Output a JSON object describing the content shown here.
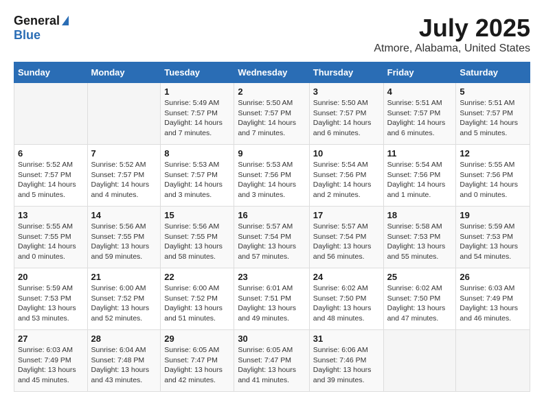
{
  "logo": {
    "general": "General",
    "blue": "Blue"
  },
  "title": "July 2025",
  "subtitle": "Atmore, Alabama, United States",
  "weekdays": [
    "Sunday",
    "Monday",
    "Tuesday",
    "Wednesday",
    "Thursday",
    "Friday",
    "Saturday"
  ],
  "weeks": [
    [
      {
        "day": "",
        "sunrise": "",
        "sunset": "",
        "daylight": ""
      },
      {
        "day": "",
        "sunrise": "",
        "sunset": "",
        "daylight": ""
      },
      {
        "day": "1",
        "sunrise": "Sunrise: 5:49 AM",
        "sunset": "Sunset: 7:57 PM",
        "daylight": "Daylight: 14 hours and 7 minutes."
      },
      {
        "day": "2",
        "sunrise": "Sunrise: 5:50 AM",
        "sunset": "Sunset: 7:57 PM",
        "daylight": "Daylight: 14 hours and 7 minutes."
      },
      {
        "day": "3",
        "sunrise": "Sunrise: 5:50 AM",
        "sunset": "Sunset: 7:57 PM",
        "daylight": "Daylight: 14 hours and 6 minutes."
      },
      {
        "day": "4",
        "sunrise": "Sunrise: 5:51 AM",
        "sunset": "Sunset: 7:57 PM",
        "daylight": "Daylight: 14 hours and 6 minutes."
      },
      {
        "day": "5",
        "sunrise": "Sunrise: 5:51 AM",
        "sunset": "Sunset: 7:57 PM",
        "daylight": "Daylight: 14 hours and 5 minutes."
      }
    ],
    [
      {
        "day": "6",
        "sunrise": "Sunrise: 5:52 AM",
        "sunset": "Sunset: 7:57 PM",
        "daylight": "Daylight: 14 hours and 5 minutes."
      },
      {
        "day": "7",
        "sunrise": "Sunrise: 5:52 AM",
        "sunset": "Sunset: 7:57 PM",
        "daylight": "Daylight: 14 hours and 4 minutes."
      },
      {
        "day": "8",
        "sunrise": "Sunrise: 5:53 AM",
        "sunset": "Sunset: 7:57 PM",
        "daylight": "Daylight: 14 hours and 3 minutes."
      },
      {
        "day": "9",
        "sunrise": "Sunrise: 5:53 AM",
        "sunset": "Sunset: 7:56 PM",
        "daylight": "Daylight: 14 hours and 3 minutes."
      },
      {
        "day": "10",
        "sunrise": "Sunrise: 5:54 AM",
        "sunset": "Sunset: 7:56 PM",
        "daylight": "Daylight: 14 hours and 2 minutes."
      },
      {
        "day": "11",
        "sunrise": "Sunrise: 5:54 AM",
        "sunset": "Sunset: 7:56 PM",
        "daylight": "Daylight: 14 hours and 1 minute."
      },
      {
        "day": "12",
        "sunrise": "Sunrise: 5:55 AM",
        "sunset": "Sunset: 7:56 PM",
        "daylight": "Daylight: 14 hours and 0 minutes."
      }
    ],
    [
      {
        "day": "13",
        "sunrise": "Sunrise: 5:55 AM",
        "sunset": "Sunset: 7:55 PM",
        "daylight": "Daylight: 14 hours and 0 minutes."
      },
      {
        "day": "14",
        "sunrise": "Sunrise: 5:56 AM",
        "sunset": "Sunset: 7:55 PM",
        "daylight": "Daylight: 13 hours and 59 minutes."
      },
      {
        "day": "15",
        "sunrise": "Sunrise: 5:56 AM",
        "sunset": "Sunset: 7:55 PM",
        "daylight": "Daylight: 13 hours and 58 minutes."
      },
      {
        "day": "16",
        "sunrise": "Sunrise: 5:57 AM",
        "sunset": "Sunset: 7:54 PM",
        "daylight": "Daylight: 13 hours and 57 minutes."
      },
      {
        "day": "17",
        "sunrise": "Sunrise: 5:57 AM",
        "sunset": "Sunset: 7:54 PM",
        "daylight": "Daylight: 13 hours and 56 minutes."
      },
      {
        "day": "18",
        "sunrise": "Sunrise: 5:58 AM",
        "sunset": "Sunset: 7:53 PM",
        "daylight": "Daylight: 13 hours and 55 minutes."
      },
      {
        "day": "19",
        "sunrise": "Sunrise: 5:59 AM",
        "sunset": "Sunset: 7:53 PM",
        "daylight": "Daylight: 13 hours and 54 minutes."
      }
    ],
    [
      {
        "day": "20",
        "sunrise": "Sunrise: 5:59 AM",
        "sunset": "Sunset: 7:53 PM",
        "daylight": "Daylight: 13 hours and 53 minutes."
      },
      {
        "day": "21",
        "sunrise": "Sunrise: 6:00 AM",
        "sunset": "Sunset: 7:52 PM",
        "daylight": "Daylight: 13 hours and 52 minutes."
      },
      {
        "day": "22",
        "sunrise": "Sunrise: 6:00 AM",
        "sunset": "Sunset: 7:52 PM",
        "daylight": "Daylight: 13 hours and 51 minutes."
      },
      {
        "day": "23",
        "sunrise": "Sunrise: 6:01 AM",
        "sunset": "Sunset: 7:51 PM",
        "daylight": "Daylight: 13 hours and 49 minutes."
      },
      {
        "day": "24",
        "sunrise": "Sunrise: 6:02 AM",
        "sunset": "Sunset: 7:50 PM",
        "daylight": "Daylight: 13 hours and 48 minutes."
      },
      {
        "day": "25",
        "sunrise": "Sunrise: 6:02 AM",
        "sunset": "Sunset: 7:50 PM",
        "daylight": "Daylight: 13 hours and 47 minutes."
      },
      {
        "day": "26",
        "sunrise": "Sunrise: 6:03 AM",
        "sunset": "Sunset: 7:49 PM",
        "daylight": "Daylight: 13 hours and 46 minutes."
      }
    ],
    [
      {
        "day": "27",
        "sunrise": "Sunrise: 6:03 AM",
        "sunset": "Sunset: 7:49 PM",
        "daylight": "Daylight: 13 hours and 45 minutes."
      },
      {
        "day": "28",
        "sunrise": "Sunrise: 6:04 AM",
        "sunset": "Sunset: 7:48 PM",
        "daylight": "Daylight: 13 hours and 43 minutes."
      },
      {
        "day": "29",
        "sunrise": "Sunrise: 6:05 AM",
        "sunset": "Sunset: 7:47 PM",
        "daylight": "Daylight: 13 hours and 42 minutes."
      },
      {
        "day": "30",
        "sunrise": "Sunrise: 6:05 AM",
        "sunset": "Sunset: 7:47 PM",
        "daylight": "Daylight: 13 hours and 41 minutes."
      },
      {
        "day": "31",
        "sunrise": "Sunrise: 6:06 AM",
        "sunset": "Sunset: 7:46 PM",
        "daylight": "Daylight: 13 hours and 39 minutes."
      },
      {
        "day": "",
        "sunrise": "",
        "sunset": "",
        "daylight": ""
      },
      {
        "day": "",
        "sunrise": "",
        "sunset": "",
        "daylight": ""
      }
    ]
  ]
}
